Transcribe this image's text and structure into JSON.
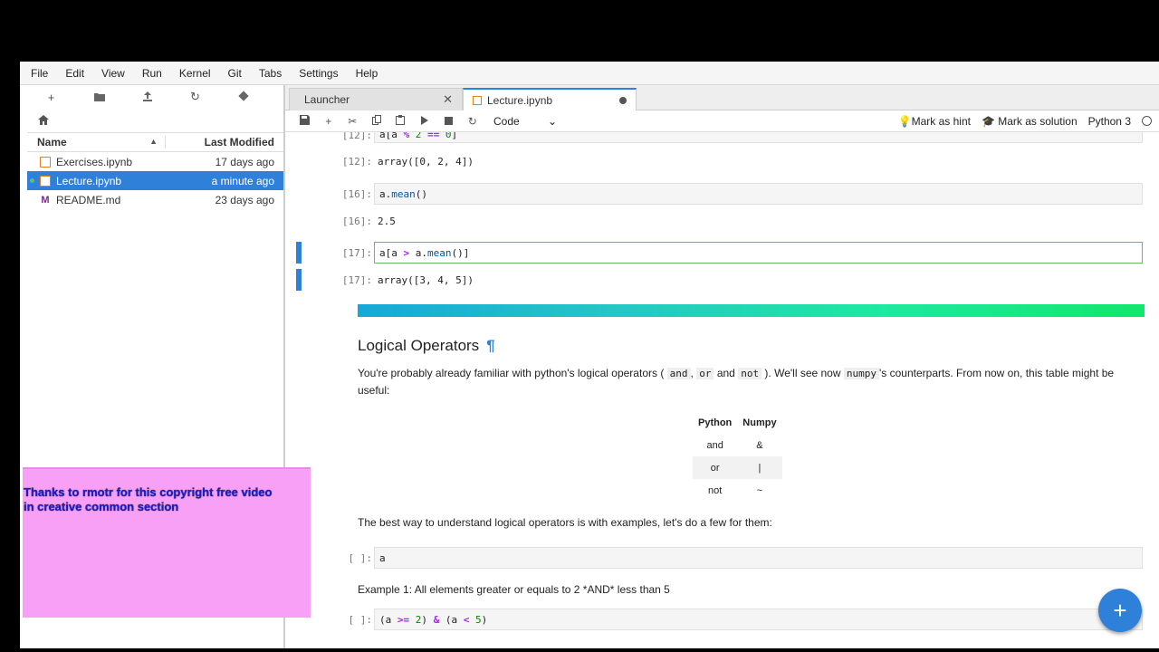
{
  "menubar": {
    "items": [
      "File",
      "Edit",
      "View",
      "Run",
      "Kernel",
      "Git",
      "Tabs",
      "Settings",
      "Help"
    ]
  },
  "sidebar": {
    "toolbar_icons": [
      "new-launcher-icon",
      "new-folder-icon",
      "upload-icon",
      "refresh-icon",
      "git-icon"
    ],
    "breadcrumb_icon": "home-icon",
    "header": {
      "name": "Name",
      "last_modified": "Last Modified"
    },
    "files": [
      {
        "name": "Exercises.ipynb",
        "modified": "17 days ago",
        "type": "notebook"
      },
      {
        "name": "Lecture.ipynb",
        "modified": "a minute ago",
        "type": "notebook",
        "selected": true
      },
      {
        "name": "README.md",
        "modified": "23 days ago",
        "type": "markdown",
        "icon_letter": "M"
      }
    ]
  },
  "tabs": [
    {
      "label": "Launcher",
      "close": "✕"
    },
    {
      "label": "Lecture.ipynb",
      "modified": true
    }
  ],
  "nb_toolbar": {
    "cell_type": "Code",
    "mark_hint": "Mark as hint",
    "mark_solution": "Mark as solution",
    "kernel": "Python 3"
  },
  "cells": {
    "c12_prompt": "[12]:",
    "c12_out": "array([0, 2, 4])",
    "c16_prompt": "[16]:",
    "c16_out": "2.5",
    "c17_prompt": "[17]:",
    "c17_out": "array([3, 4, 5])",
    "empty_prompt": "[ ]:",
    "cell_a_code": "a"
  },
  "markdown": {
    "heading": "Logical Operators",
    "pilcrow": "¶",
    "intro_1": "You're probably already familiar with python's logical operators (",
    "code_and": "and",
    "comma": ",",
    "code_or": "or",
    "and_word": "and",
    "code_not": "not",
    "intro_2": "). We'll see now",
    "code_numpy": "numpy",
    "intro_3": "'s counterparts. From now on, this table might be useful:",
    "table": {
      "headers": [
        "Python",
        "Numpy"
      ],
      "rows": [
        [
          "and",
          "&"
        ],
        [
          "or",
          "|"
        ],
        [
          "not",
          "~"
        ]
      ]
    },
    "best_way": "The best way to understand logical operators is with examples, let's do a few for them:",
    "example1": "Example 1: All elements greater or equals to 2 *AND* less than 5"
  },
  "overlay": {
    "line1": "Thanks to rmotr for this copyright free video",
    "line2": "in creative common section",
    "color": "#f7a0f5"
  },
  "fab": {
    "label": "+"
  },
  "colors": {
    "accent": "#2f80d9",
    "notebook_icon": "#e67e22"
  }
}
